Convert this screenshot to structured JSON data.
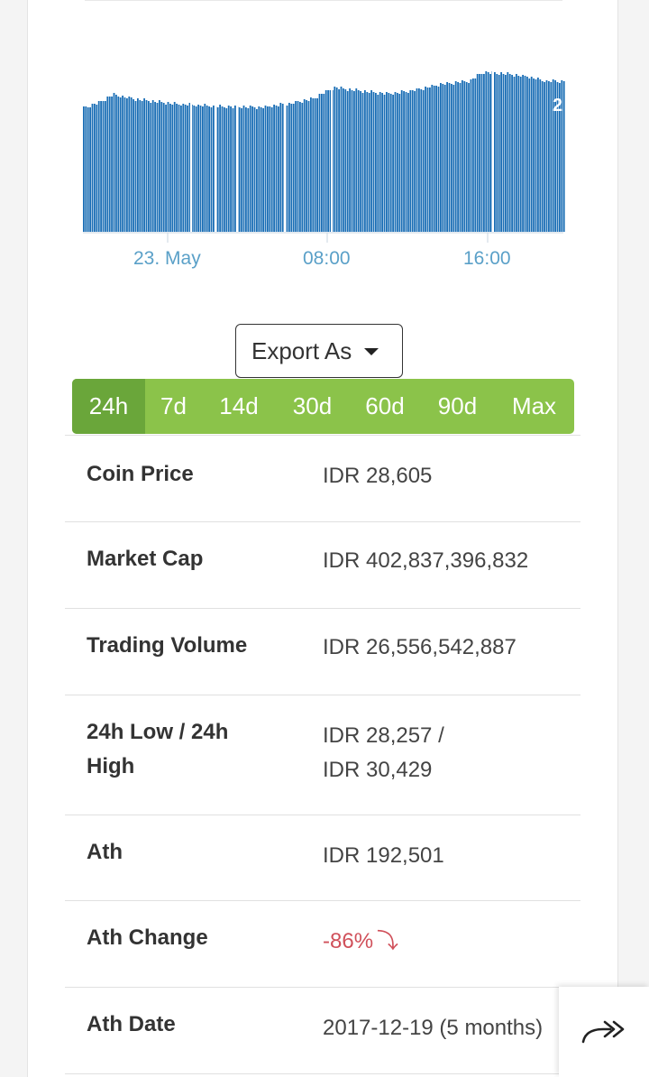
{
  "chart": {
    "x_tick_labels": [
      "23. May",
      "08:00",
      "16:00"
    ],
    "edge_label": "2",
    "bar_color": "#1a6eb5"
  },
  "export": {
    "label": "Export As"
  },
  "tabs": [
    {
      "label": "24h",
      "active": true
    },
    {
      "label": "7d",
      "active": false
    },
    {
      "label": "14d",
      "active": false
    },
    {
      "label": "30d",
      "active": false
    },
    {
      "label": "60d",
      "active": false
    },
    {
      "label": "90d",
      "active": false
    },
    {
      "label": "Max",
      "active": false
    }
  ],
  "stats": [
    {
      "key": "Coin Price",
      "value": "IDR 28,605"
    },
    {
      "key": "Market Cap",
      "value": "IDR 402,837,396,832"
    },
    {
      "key": "Trading Volume",
      "value": "IDR 26,556,542,887"
    },
    {
      "key": "24h Low / 24h High",
      "value_line1": "IDR 28,257 /",
      "value_line2": "IDR 30,429"
    },
    {
      "key": "Ath",
      "value": "IDR 192,501"
    },
    {
      "key": "Ath Change",
      "value": "-86%",
      "trend": "down"
    },
    {
      "key": "Ath Date",
      "value": "2017-12-19 (5 months)"
    }
  ],
  "share": {
    "icon": "share-arrow-icon"
  },
  "colors": {
    "tab_bg": "#8bc34a",
    "tab_active": "#6aa63a",
    "negative": "#d0505a",
    "axis_label": "#5aa0c8"
  }
}
